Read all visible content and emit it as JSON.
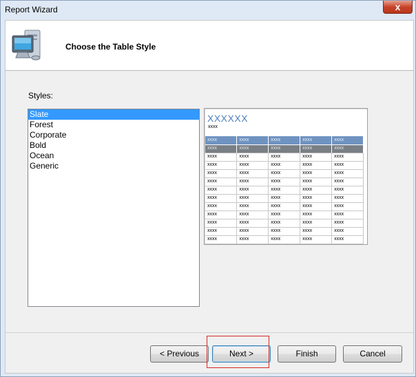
{
  "window": {
    "title": "Report Wizard",
    "close_glyph": "x"
  },
  "header": {
    "title": "Choose the Table Style",
    "icon": "computer-icon"
  },
  "styles": {
    "label": "Styles:",
    "items": [
      "Slate",
      "Forest",
      "Corporate",
      "Bold",
      "Ocean",
      "Generic"
    ],
    "selected": "Slate"
  },
  "preview": {
    "title": "XXXXXX",
    "subtitle": "xxxx",
    "cell_text": "xxxx",
    "header_color": "#6f93c1",
    "group_color": "#7a7f85",
    "title_color": "#4f81bd"
  },
  "buttons": {
    "previous": "< Previous",
    "next": "Next >",
    "finish": "Finish",
    "cancel": "Cancel"
  }
}
